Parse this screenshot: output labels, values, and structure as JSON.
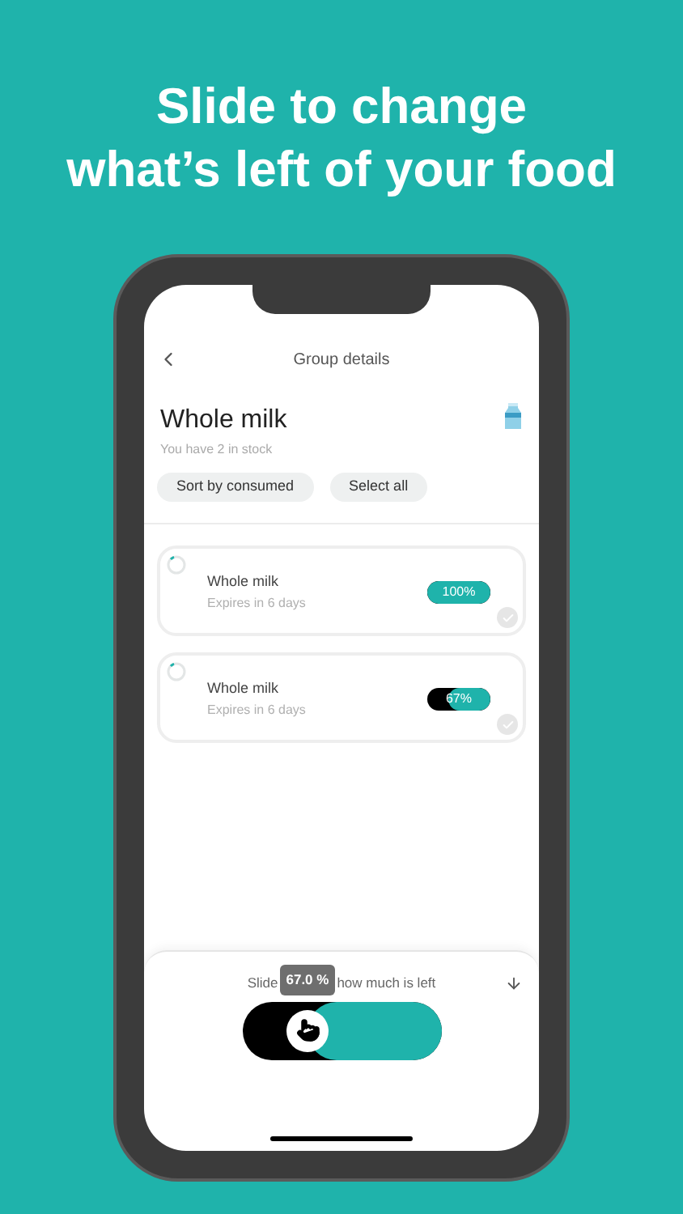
{
  "headline": [
    "Slide to change",
    "what’s left of your food"
  ],
  "screen": {
    "title": "Group details",
    "product": {
      "name": "Whole milk",
      "stock": "You have 2 in stock"
    },
    "actions": [
      "Sort by consumed",
      "Select all"
    ],
    "items": [
      {
        "name": "Whole milk",
        "expiry": "Expires in 6 days",
        "level": 1,
        "percent": "100%",
        "checked": false
      },
      {
        "name": "Whole milk",
        "expiry": "Expires in 6 days",
        "level": 0.67,
        "percent": "67%",
        "checked": false
      }
    ],
    "slider": {
      "hint_start": "Slide",
      "hint_end": "how much is left",
      "tooltip": "67.0 %",
      "level": 0.67
    }
  }
}
